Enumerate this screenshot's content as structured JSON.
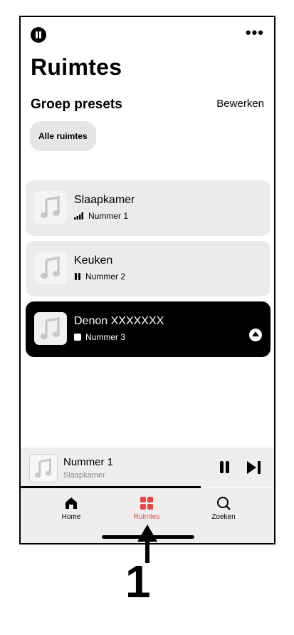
{
  "header": {
    "title": "Ruimtes",
    "more_label": "•••"
  },
  "presets": {
    "section_title": "Groep presets",
    "edit_label": "Bewerken",
    "chips": [
      "Alle ruimtes"
    ]
  },
  "rooms": [
    {
      "name": "Slaapkamer",
      "status": "Nummer 1",
      "state_icon": "signal-icon"
    },
    {
      "name": "Keuken",
      "status": "Nummer 2",
      "state_icon": "pause-icon"
    },
    {
      "name": "Denon XXXXXXX",
      "status": "Nummer 3",
      "state_icon": "stop-icon",
      "active": true
    }
  ],
  "now_playing": {
    "track": "Nummer 1",
    "room": "Slaapkamer",
    "progress": 0.7
  },
  "tabs": [
    {
      "label": "Home",
      "icon": "home-icon"
    },
    {
      "label": "Ruimtes",
      "icon": "grid-icon",
      "active": true
    },
    {
      "label": "Zoeken",
      "icon": "search-icon"
    }
  ],
  "callout": {
    "number": "1"
  },
  "colors": {
    "accent": "#e8453c",
    "active_row": "#000000",
    "row_bg": "#ebebeb"
  }
}
